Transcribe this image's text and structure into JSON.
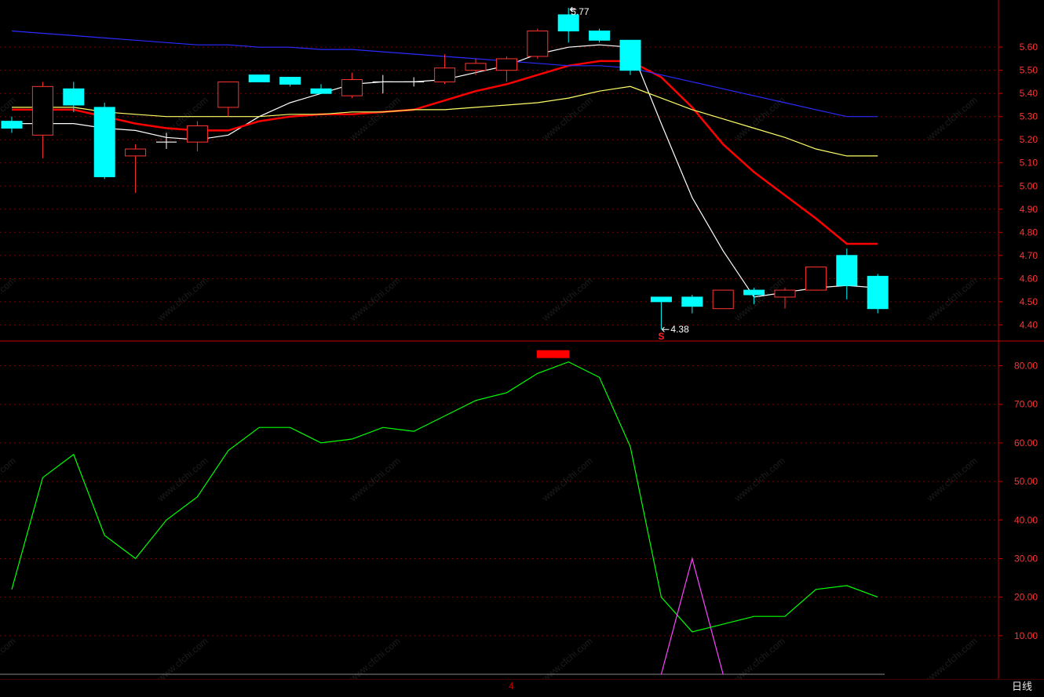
{
  "watermark_text": "www.cfchi.com",
  "bottom": {
    "date_marker": "4",
    "period_label": "日线"
  },
  "chart_data": [
    {
      "type": "candlestick",
      "panel": "price",
      "ylim": [
        4.33,
        5.77
      ],
      "yticks": [
        4.4,
        4.5,
        4.6,
        4.7,
        4.8,
        4.9,
        5.0,
        5.1,
        5.2,
        5.3,
        5.4,
        5.5,
        5.6
      ],
      "grid": true,
      "colors": {
        "up": "#ff3333",
        "down": "#00ffff",
        "doji": "#ffffff",
        "axis": "#c00000",
        "tick_label": "#ff3333"
      },
      "annotations": {
        "high_label": "5.77",
        "low_label": "4.38",
        "signal_label": "S"
      },
      "candles": [
        {
          "o": 5.28,
          "h": 5.3,
          "l": 5.23,
          "c": 5.25
        },
        {
          "o": 5.22,
          "h": 5.45,
          "l": 5.12,
          "c": 5.43
        },
        {
          "o": 5.42,
          "h": 5.45,
          "l": 5.32,
          "c": 5.35
        },
        {
          "o": 5.34,
          "h": 5.36,
          "l": 5.03,
          "c": 5.04
        },
        {
          "o": 5.13,
          "h": 5.18,
          "l": 4.97,
          "c": 5.16
        },
        {
          "o": 5.19,
          "h": 5.23,
          "l": 5.16,
          "c": 5.19
        },
        {
          "o": 5.19,
          "h": 5.28,
          "l": 5.15,
          "c": 5.26
        },
        {
          "o": 5.34,
          "h": 5.45,
          "l": 5.3,
          "c": 5.45
        },
        {
          "o": 5.48,
          "h": 5.48,
          "l": 5.45,
          "c": 5.45
        },
        {
          "o": 5.47,
          "h": 5.47,
          "l": 5.43,
          "c": 5.44
        },
        {
          "o": 5.42,
          "h": 5.44,
          "l": 5.4,
          "c": 5.4
        },
        {
          "o": 5.39,
          "h": 5.49,
          "l": 5.38,
          "c": 5.46
        },
        {
          "o": 5.45,
          "h": 5.48,
          "l": 5.4,
          "c": 5.45
        },
        {
          "o": 5.45,
          "h": 5.47,
          "l": 5.43,
          "c": 5.45
        },
        {
          "o": 5.45,
          "h": 5.57,
          "l": 5.44,
          "c": 5.51
        },
        {
          "o": 5.5,
          "h": 5.55,
          "l": 5.48,
          "c": 5.53
        },
        {
          "o": 5.5,
          "h": 5.56,
          "l": 5.45,
          "c": 5.55
        },
        {
          "o": 5.56,
          "h": 5.68,
          "l": 5.55,
          "c": 5.67
        },
        {
          "o": 5.74,
          "h": 5.77,
          "l": 5.62,
          "c": 5.67
        },
        {
          "o": 5.67,
          "h": 5.68,
          "l": 5.62,
          "c": 5.63
        },
        {
          "o": 5.63,
          "h": 5.63,
          "l": 5.48,
          "c": 5.5
        },
        {
          "o": 4.52,
          "h": 4.52,
          "l": 4.38,
          "c": 4.5
        },
        {
          "o": 4.52,
          "h": 4.53,
          "l": 4.45,
          "c": 4.48
        },
        {
          "o": 4.47,
          "h": 4.55,
          "l": 4.47,
          "c": 4.55
        },
        {
          "o": 4.55,
          "h": 4.56,
          "l": 4.49,
          "c": 4.53
        },
        {
          "o": 4.52,
          "h": 4.56,
          "l": 4.47,
          "c": 4.55
        },
        {
          "o": 4.55,
          "h": 4.65,
          "l": 4.55,
          "c": 4.65
        },
        {
          "o": 4.7,
          "h": 4.73,
          "l": 4.51,
          "c": 4.57
        },
        {
          "o": 4.61,
          "h": 4.62,
          "l": 4.45,
          "c": 4.47
        }
      ],
      "series": [
        {
          "color": "#ffffff",
          "values": [
            5.27,
            5.27,
            5.27,
            5.25,
            5.24,
            5.21,
            5.2,
            5.22,
            5.3,
            5.36,
            5.4,
            5.44,
            5.45,
            5.45,
            5.46,
            5.49,
            5.52,
            5.57,
            5.6,
            5.61,
            5.6,
            5.27,
            4.95,
            4.72,
            4.52,
            4.54,
            4.56,
            4.57,
            4.56
          ]
        },
        {
          "color": "#ff0000",
          "values": [
            5.33,
            5.33,
            5.33,
            5.3,
            5.27,
            5.25,
            5.24,
            5.24,
            5.28,
            5.3,
            5.31,
            5.31,
            5.32,
            5.33,
            5.37,
            5.41,
            5.44,
            5.48,
            5.52,
            5.54,
            5.54,
            5.47,
            5.34,
            5.18,
            5.06,
            4.96,
            4.86,
            4.75,
            4.75
          ]
        },
        {
          "color": "#ffff66",
          "values": [
            5.34,
            5.34,
            5.34,
            5.32,
            5.31,
            5.3,
            5.3,
            5.3,
            5.3,
            5.31,
            5.31,
            5.32,
            5.32,
            5.33,
            5.33,
            5.34,
            5.35,
            5.36,
            5.38,
            5.41,
            5.43,
            5.38,
            5.33,
            5.29,
            5.25,
            5.21,
            5.16,
            5.13,
            5.13
          ]
        },
        {
          "color": "#2a2aff",
          "values": [
            5.67,
            5.66,
            5.65,
            5.64,
            5.63,
            5.62,
            5.61,
            5.61,
            5.6,
            5.6,
            5.59,
            5.59,
            5.58,
            5.57,
            5.56,
            5.55,
            5.54,
            5.53,
            5.52,
            5.52,
            5.51,
            5.48,
            5.45,
            5.42,
            5.39,
            5.36,
            5.33,
            5.3,
            5.3
          ]
        }
      ]
    },
    {
      "type": "line",
      "panel": "indicator",
      "ylim": [
        0,
        86
      ],
      "yticks": [
        10.0,
        20.0,
        30.0,
        40.0,
        50.0,
        60.0,
        70.0,
        80.0
      ],
      "grid": true,
      "series": [
        {
          "color": "#00ff00",
          "values": [
            22,
            51,
            57,
            36,
            30,
            40,
            46,
            58,
            64,
            64,
            60,
            61,
            64,
            63,
            67,
            71,
            73,
            78,
            81,
            77,
            59,
            20,
            11,
            13,
            15,
            15,
            22,
            23,
            20
          ]
        },
        {
          "color": "#ff44ff",
          "values": [
            null,
            null,
            null,
            null,
            null,
            null,
            null,
            null,
            null,
            null,
            null,
            null,
            null,
            null,
            null,
            null,
            null,
            null,
            null,
            null,
            null,
            0,
            30,
            0,
            null,
            null,
            null,
            null,
            null
          ]
        }
      ],
      "signal_bar": {
        "color": "#ff0000",
        "value": 82,
        "from_index": 17,
        "to_index": 18
      }
    }
  ]
}
